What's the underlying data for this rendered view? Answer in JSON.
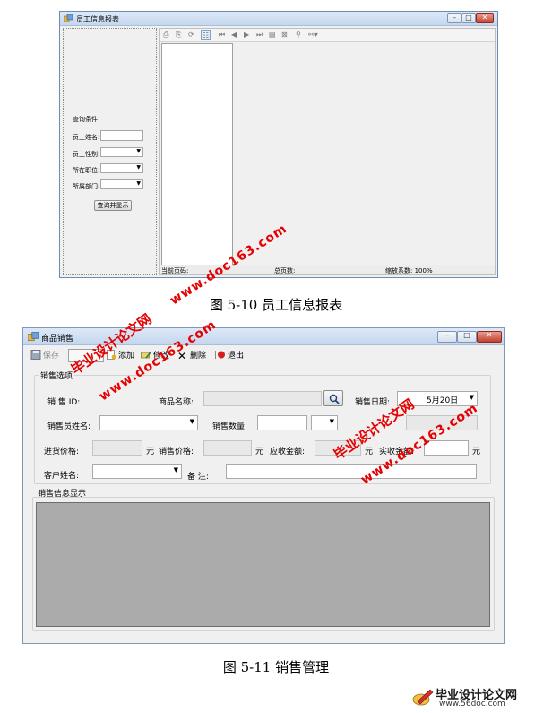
{
  "figure1": {
    "window_title": "员工信息报表",
    "query_group": {
      "title": "查询条件",
      "fields": [
        {
          "label": "员工姓名:"
        },
        {
          "label": "员工性别:"
        },
        {
          "label": "所在职位:"
        },
        {
          "label": "所属部门:"
        }
      ],
      "button": "查询并显示"
    },
    "report_status": {
      "current_page": "当前页码:",
      "total_pages": "总页数:",
      "zoom": "缩放系数: 100%"
    }
  },
  "caption1": "图 5-10 员工信息报表",
  "figure2": {
    "window_title": "商品销售",
    "toolbar": {
      "save": "保存",
      "add": "添加",
      "edit": "修改",
      "delete": "删除",
      "exit": "退出"
    },
    "sales_group": {
      "title": "销售选项",
      "sale_id_label": "销 售 ID:",
      "product_name_label": "商品名称:",
      "sale_date_label": "销售日期:",
      "sale_date_value": "5月20日",
      "salesperson_label": "销售员姓名:",
      "quantity_label": "销售数量:",
      "purchase_price_label": "进货价格:",
      "unit": "元",
      "sale_price_label": "销售价格:",
      "receivable_label": "应收金额:",
      "received_label": "实收金额:",
      "customer_label": "客户姓名:",
      "remark_label": "备   注:"
    },
    "info_group": {
      "title": "销售信息显示"
    }
  },
  "caption2": "图 5-11 销售管理",
  "watermarks": {
    "cn": "毕业设计论文网",
    "url": "www.doc163.com"
  },
  "logo": {
    "title": "毕业设计论文网",
    "url": "www.56doc.com"
  },
  "colors": {
    "watermark": "#e60000",
    "titlebar": "#c4d7ee",
    "grid_bg": "#ababab"
  }
}
